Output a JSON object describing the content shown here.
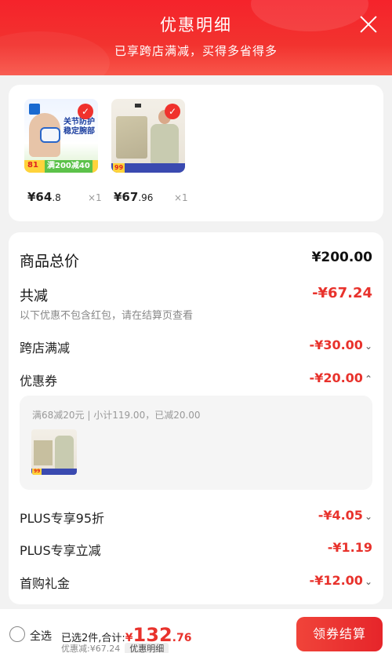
{
  "header": {
    "title": "优惠明细",
    "subtitle": "已享跨店满减，买得多省得多"
  },
  "products": [
    {
      "price_main": "¥64",
      "price_decimal": ".8",
      "qty": "×1",
      "img_text1": "关节防护",
      "img_text2": "稳定腕部",
      "img_price": "81",
      "img_deal": "满200减40"
    },
    {
      "price_main": "¥67",
      "price_decimal": ".96",
      "qty": "×1",
      "img_price": "99"
    }
  ],
  "summary": {
    "total_label": "商品总价",
    "total_value": "¥200.00",
    "discount_label": "共减",
    "discount_value": "-¥67.24",
    "discount_note": "以下优惠不包含红包，请在结算页查看",
    "rows": [
      {
        "label": "跨店满减",
        "value": "-¥30.00",
        "chevron": "⌄"
      },
      {
        "label": "优惠券",
        "value": "-¥20.00",
        "chevron": "⌃"
      },
      {
        "label": "PLUS专享95折",
        "value": "-¥4.05",
        "chevron": "⌄"
      },
      {
        "label": "PLUS专享立减",
        "value": "-¥1.19",
        "chevron": ""
      },
      {
        "label": "首购礼金",
        "value": "-¥12.00",
        "chevron": "⌄"
      }
    ],
    "coupon_detail": "满68减20元 | 小计119.00，已减20.00",
    "coupon_thumb_price": "99"
  },
  "bottom": {
    "select_all": "全选",
    "selected_prefix": "已选2件,合计:",
    "currency": "¥",
    "amount_main": "132",
    "amount_decimal": ".76",
    "discount_text": "优惠减:¥67.24",
    "detail_tag": "优惠明细",
    "checkout": "领券结算"
  },
  "colors": {
    "accent": "#e8322c",
    "header": "#f5232b"
  }
}
